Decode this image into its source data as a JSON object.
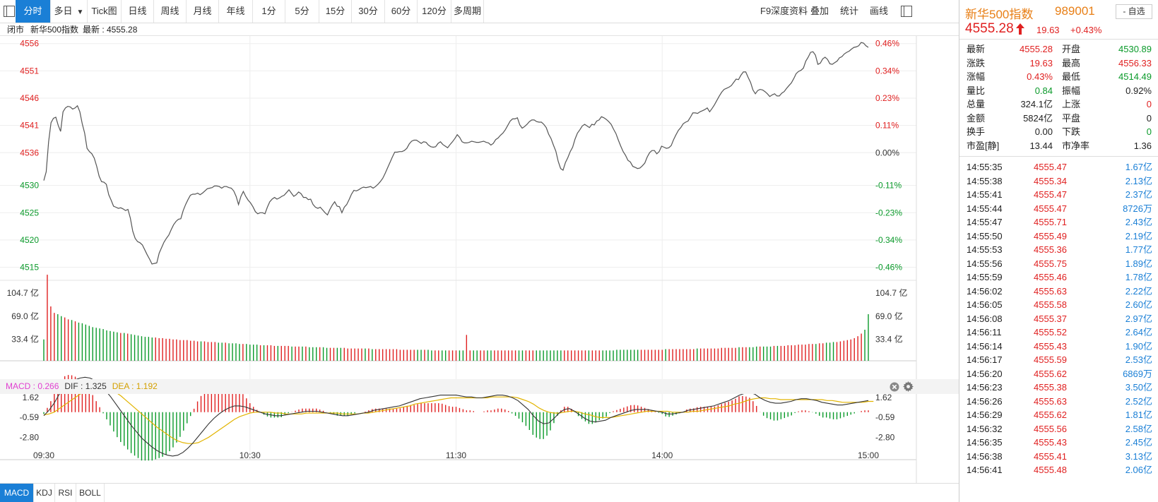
{
  "toolbar": {
    "buttons": [
      "分时",
      "多日",
      "Tick图",
      "日线",
      "周线",
      "月线",
      "年线",
      "1分",
      "5分",
      "15分",
      "30分",
      "60分",
      "120分",
      "多周期"
    ],
    "active": "分时",
    "multi_day_caret": "▼",
    "right_buttons": [
      "F9深度资料",
      "叠加",
      "统计",
      "画线"
    ]
  },
  "status": {
    "market": "闭市",
    "name": "新华500指数",
    "latest_label": "最新 : 4555.28"
  },
  "macd_header": {
    "macd": "MACD : 0.266",
    "dif": "DIF : 1.325",
    "dea": "DEA : 1.192"
  },
  "bottom_tabs": [
    "MACD",
    "KDJ",
    "RSI",
    "BOLL"
  ],
  "colors": {
    "up": "#e02020",
    "down": "#0a9a2a",
    "accent": "#1a7fd6",
    "quote_title": "#e87f16",
    "dif": "#333333",
    "dea": "#e2b400",
    "macd_label": "#e040d0"
  },
  "quote": {
    "name": "新华500指数",
    "code": "989001",
    "fav_label": "- 自选",
    "price": "4555.28",
    "change": "19.63",
    "change_pct": "+0.43%",
    "rows": [
      {
        "l1": "最新",
        "v1": "4555.28",
        "c1": "red",
        "l2": "开盘",
        "v2": "4530.89",
        "c2": "green"
      },
      {
        "l1": "涨跌",
        "v1": "19.63",
        "c1": "red",
        "l2": "最高",
        "v2": "4556.33",
        "c2": "red"
      },
      {
        "l1": "涨幅",
        "v1": "0.43%",
        "c1": "red",
        "l2": "最低",
        "v2": "4514.49",
        "c2": "green"
      },
      {
        "l1": "量比",
        "v1": "0.84",
        "c1": "green",
        "l2": "振幅",
        "v2": "0.92%",
        "c2": "blk"
      },
      {
        "l1": "总量",
        "v1": "324.1亿",
        "c1": "blk",
        "l2": "上涨",
        "v2": "0",
        "c2": "red"
      },
      {
        "l1": "金额",
        "v1": "5824亿",
        "c1": "blk",
        "l2": "平盘",
        "v2": "0",
        "c2": "blk"
      },
      {
        "l1": "换手",
        "v1": "0.00",
        "c1": "blk",
        "l2": "下跌",
        "v2": "0",
        "c2": "green"
      },
      {
        "l1": "市盈[静]",
        "v1": "13.44",
        "c1": "blk",
        "l2": "市净率",
        "v2": "1.36",
        "c2": "blk"
      }
    ],
    "ticks": [
      {
        "t": "14:55:35",
        "p": "4555.47",
        "v": "1.67亿"
      },
      {
        "t": "14:55:38",
        "p": "4555.34",
        "v": "2.13亿"
      },
      {
        "t": "14:55:41",
        "p": "4555.47",
        "v": "2.37亿"
      },
      {
        "t": "14:55:44",
        "p": "4555.47",
        "v": "8726万"
      },
      {
        "t": "14:55:47",
        "p": "4555.71",
        "v": "2.43亿"
      },
      {
        "t": "14:55:50",
        "p": "4555.49",
        "v": "2.19亿"
      },
      {
        "t": "14:55:53",
        "p": "4555.36",
        "v": "1.77亿"
      },
      {
        "t": "14:55:56",
        "p": "4555.75",
        "v": "1.89亿"
      },
      {
        "t": "14:55:59",
        "p": "4555.46",
        "v": "1.78亿"
      },
      {
        "t": "14:56:02",
        "p": "4555.63",
        "v": "2.22亿"
      },
      {
        "t": "14:56:05",
        "p": "4555.58",
        "v": "2.60亿"
      },
      {
        "t": "14:56:08",
        "p": "4555.37",
        "v": "2.97亿"
      },
      {
        "t": "14:56:11",
        "p": "4555.52",
        "v": "2.64亿"
      },
      {
        "t": "14:56:14",
        "p": "4555.43",
        "v": "1.90亿"
      },
      {
        "t": "14:56:17",
        "p": "4555.59",
        "v": "2.53亿"
      },
      {
        "t": "14:56:20",
        "p": "4555.62",
        "v": "6869万"
      },
      {
        "t": "14:56:23",
        "p": "4555.38",
        "v": "3.50亿"
      },
      {
        "t": "14:56:26",
        "p": "4555.63",
        "v": "2.52亿"
      },
      {
        "t": "14:56:29",
        "p": "4555.62",
        "v": "1.81亿"
      },
      {
        "t": "14:56:32",
        "p": "4555.56",
        "v": "2.58亿"
      },
      {
        "t": "14:56:35",
        "p": "4555.43",
        "v": "2.45亿"
      },
      {
        "t": "14:56:38",
        "p": "4555.41",
        "v": "3.13亿"
      },
      {
        "t": "14:56:41",
        "p": "4555.48",
        "v": "2.06亿"
      }
    ]
  },
  "chart_data": {
    "type": "line",
    "prev_close": 4535.65,
    "price_axis": {
      "ylim": [
        4513,
        4557
      ],
      "left_ticks": [
        "4556",
        "4551",
        "4546",
        "4541",
        "4536",
        "4530",
        "4525",
        "4520",
        "4515"
      ],
      "left_tick_values": [
        4556,
        4551,
        4546,
        4541,
        4536,
        4530,
        4525,
        4520,
        4515
      ],
      "right_ticks": [
        "0.46%",
        "0.34%",
        "0.23%",
        "0.11%",
        "0.00%",
        "-0.11%",
        "-0.23%",
        "-0.34%",
        "-0.46%"
      ]
    },
    "time_ticks": [
      "09:30",
      "10:30",
      "11:30",
      "14:00",
      "15:00"
    ],
    "time_tick_index": [
      0,
      60,
      120,
      180,
      240
    ],
    "price": [
      4530.9,
      4532.5,
      4538,
      4541.5,
      4542.3,
      4542.5,
      4541,
      4539.9,
      4543.5,
      4544.2,
      4544.5,
      4544.4,
      4544,
      4544.2,
      4544.6,
      4543.5,
      4541.3,
      4539.6,
      4536.8,
      4536.2,
      4535.8,
      4535,
      4533.5,
      4531.7,
      4530.7,
      4530.6,
      4530.2,
      4528.3,
      4527.3,
      4526.2,
      4526,
      4525.8,
      4525.9,
      4525.7,
      4525.4,
      4525.6,
      4524,
      4521.6,
      4520.3,
      4519.7,
      4519.5,
      4519.1,
      4518.2,
      4517.3,
      4516.5,
      4515.6,
      4515.7,
      4515.8,
      4517.6,
      4518.6,
      4519.6,
      4520.3,
      4520.9,
      4521.9,
      4522.8,
      4523.4,
      4523.8,
      4523.9,
      4525.4,
      4526.5,
      4527.4,
      4528.2,
      4528.4,
      4528.4,
      4528.6,
      4528.3,
      4528.6,
      4529,
      4529.4,
      4529.5,
      4529.6,
      4529.9,
      4529.9,
      4529.8,
      4529.5,
      4529.8,
      4529.8,
      4529.6,
      4529.5,
      4529,
      4528,
      4526.5,
      4528,
      4528.9,
      4528,
      4527.3,
      4526.8,
      4526.1,
      4525.2,
      4524.8,
      4525,
      4525,
      4524.8,
      4526,
      4527,
      4527.5,
      4527.8,
      4527.5,
      4527.7,
      4528,
      4528.2,
      4528.7,
      4529.2,
      4528.6,
      4528,
      4528.3,
      4528.8,
      4528.5,
      4527.8,
      4527.8,
      4527.4,
      4527.5,
      4526.5,
      4526,
      4525.8,
      4526,
      4525.5,
      4525,
      4524.6,
      4525.6,
      4526.4,
      4527,
      4526.2,
      4526.1,
      4525,
      4526,
      4526.5,
      4527.4,
      4528.4,
      4529.1,
      4529,
      4529.2,
      4529.5,
      4529.7,
      4529.6,
      4529.7,
      4529.8,
      4529.5,
      4529.8,
      4530.2,
      4530.7,
      4531.3,
      4532.2,
      4533.2,
      4534.2,
      4535.2,
      4536.1,
      4536.1,
      4536.2,
      4536.2,
      4536.4,
      4536.8,
      4537.6,
      4538.1,
      4538.3,
      4538.3,
      4538,
      4537.7,
      4538,
      4537.9,
      4537.4,
      4537.1,
      4537,
      4537.1,
      4537.7,
      4538,
      4537.5,
      4537.2,
      4536.9,
      4537.5,
      4538,
      4538.6,
      4539.3,
      4538.8,
      4538,
      4537.8,
      4537.8,
      4537.9,
      4538.1,
      4538,
      4537.9,
      4537.9,
      4538,
      4538.1,
      4537.9,
      4537.8,
      4537.4,
      4537.7,
      4538.4,
      4538.7,
      4539.2,
      4539.6,
      4540.2,
      4541,
      4541.8,
      4542.2,
      4542.2,
      4542.4,
      4541.1,
      4540.5,
      4540.8,
      4541.2,
      4541.7,
      4542,
      4542,
      4541.7,
      4541.6,
      4541.6,
      4541.2,
      4540.6,
      4539.4,
      4538.6,
      4537.4,
      4536.3,
      4534.4,
      4533.1,
      4532.8,
      4534.2,
      4535.1,
      4536.2,
      4537,
      4538.5,
      4539.6,
      4540.2,
      4540.9,
      4541.2,
      4540.9,
      4540.6,
      4541.2,
      4541.1,
      4541.8,
      4542,
      4542.6,
      4542.4,
      4542.1,
      4541.7,
      4541.2,
      4540.3,
      4539.5,
      4538.3,
      4537.2,
      4536.2,
      4535.5,
      4534.6,
      4534.3,
      4533.5,
      4533.3,
      4533.1,
      4533.2,
      4533.6,
      4534.1,
      4535.2,
      4536,
      4536.4,
      4536.4,
      4535.8,
      4536.2,
      4537.2,
      4537,
      4536.8,
      4536.9,
      4537.3,
      4538.4,
      4539.3,
      4540.1,
      4540.6,
      4541.3,
      4541.6,
      4541.8,
      4542.5,
      4543.3,
      4543.3,
      4543.2,
      4543.5,
      4543.7,
      4543.9,
      4544.2,
      4543.5,
      4544.1,
      4544.8,
      4545.6,
      4546.4,
      4547.1,
      4547.6,
      4547.8,
      4548,
      4548.3,
      4548.9,
      4549.5,
      4549.4,
      4550.2,
      4550.8,
      4550.8,
      4549.8,
      4548.9,
      4547.5,
      4546.8,
      4547.4,
      4547.6,
      4547.5,
      4547.2,
      4546.8,
      4546.3,
      4546.6,
      4546.8,
      4546.4,
      4546.4,
      4546.9,
      4547.2,
      4547.8,
      4548.3,
      4548.8,
      4549.6,
      4550.5,
      4550.9,
      4551.1,
      4551.5,
      4552.8,
      4553.5,
      4554.4,
      4554.5,
      4553.9,
      4552.2,
      4552.4,
      4553.2,
      4553.5,
      4553.1,
      4552.3,
      4552.2,
      4552.5,
      4552.8,
      4553.4,
      4553.6,
      4554.1,
      4554.4,
      4554.6,
      4555,
      4555.3,
      4555.4,
      4555.6,
      4556.2,
      4556.1,
      4555.6,
      4555.3
    ],
    "volume_axis": {
      "ticks": [
        "104.7 亿",
        "69.0 亿",
        "33.4 亿"
      ],
      "tick_values": [
        104.7,
        69.0,
        33.4
      ],
      "ylim": [
        0,
        120
      ]
    },
    "volume": [
      33,
      133,
      84,
      74,
      72,
      69,
      67,
      64,
      63,
      61,
      59,
      58,
      56,
      54,
      52,
      51,
      50,
      49,
      47,
      46,
      45,
      44,
      43,
      43,
      42,
      41,
      40,
      39,
      38,
      37,
      37,
      36,
      36,
      35,
      35,
      34,
      34,
      33,
      33,
      32,
      32,
      32,
      31,
      31,
      30,
      30,
      30,
      29,
      29,
      29,
      28,
      28,
      28,
      27,
      27,
      27,
      26,
      26,
      26,
      25,
      25,
      25,
      24,
      24,
      24,
      24,
      23,
      23,
      23,
      23,
      23,
      22,
      22,
      22,
      22,
      22,
      21,
      21,
      21,
      21,
      21,
      20,
      20,
      20,
      20,
      20,
      20,
      19,
      19,
      19,
      19,
      19,
      19,
      19,
      18,
      18,
      18,
      18,
      18,
      18,
      18,
      18,
      17,
      17,
      17,
      17,
      17,
      17,
      17,
      17,
      17,
      16,
      16,
      16,
      16,
      16,
      16,
      16,
      16,
      16,
      16,
      40,
      16,
      16,
      16,
      16,
      16,
      16,
      16,
      16,
      16,
      16,
      16,
      16,
      16,
      16,
      16,
      16,
      16,
      16,
      16,
      16,
      16,
      16,
      16,
      16,
      16,
      16,
      16,
      16,
      16,
      16,
      16,
      16,
      16,
      16,
      16,
      16,
      16,
      16,
      16,
      16,
      16,
      16,
      17,
      17,
      17,
      17,
      17,
      17,
      17,
      17,
      17,
      17,
      17,
      17,
      17,
      17,
      18,
      18,
      18,
      18,
      18,
      18,
      18,
      18,
      18,
      19,
      19,
      19,
      19,
      19,
      19,
      19,
      20,
      20,
      20,
      20,
      20,
      21,
      21,
      21,
      21,
      21,
      22,
      22,
      22,
      22,
      22,
      23,
      23,
      23,
      23,
      24,
      24,
      24,
      25,
      25,
      25,
      26,
      26,
      26,
      27,
      27,
      28,
      28,
      29,
      29,
      30,
      31,
      32,
      33,
      35,
      38,
      42,
      48,
      72
    ],
    "macd_axis": {
      "ticks": [
        "1.62",
        "-0.59",
        "-2.80"
      ],
      "tick_values": [
        1.62,
        -0.59,
        -2.8
      ],
      "ylim": [
        -5.3,
        4.0
      ]
    },
    "dif": [
      -0.4,
      0.2,
      1.0,
      2.0,
      2.8,
      3.3,
      3.6,
      3.8,
      3.9,
      3.8,
      3.5,
      3.0,
      2.4,
      1.7,
      0.9,
      0.1,
      -0.7,
      -1.5,
      -2.2,
      -2.9,
      -3.4,
      -3.9,
      -4.3,
      -4.6,
      -4.8,
      -4.9,
      -4.8,
      -4.5,
      -4.0,
      -3.4,
      -2.7,
      -2.0,
      -1.3,
      -0.7,
      -0.2,
      0.2,
      0.5,
      0.7,
      0.7,
      0.6,
      0.4,
      0.2,
      0.0,
      -0.2,
      -0.3,
      -0.4,
      -0.4,
      -0.3,
      -0.2,
      -0.1,
      0.0,
      0.1,
      0.1,
      0.1,
      0.0,
      -0.1,
      -0.2,
      -0.3,
      -0.4,
      -0.4,
      -0.3,
      -0.2,
      -0.1,
      0.0,
      0.2,
      0.3,
      0.4,
      0.5,
      0.6,
      0.7,
      0.9,
      1.1,
      1.3,
      1.5,
      1.6,
      1.7,
      1.8,
      1.9,
      1.9,
      1.9,
      1.9,
      1.8,
      1.7,
      1.7,
      1.6,
      1.6,
      1.7,
      1.8,
      1.9,
      1.9,
      1.8,
      1.6,
      1.3,
      0.8,
      0.3,
      -0.4,
      -1.0,
      -1.3,
      -1.2,
      -0.7,
      -0.1,
      0.3,
      0.4,
      0.1,
      -0.3,
      -0.7,
      -1.0,
      -1.1,
      -1.0,
      -0.9,
      -0.6,
      -0.4,
      -0.2,
      0.0,
      0.2,
      0.3,
      0.3,
      0.3,
      0.2,
      0.1,
      0.0,
      -0.2,
      -0.2,
      -0.1,
      0.0,
      0.2,
      0.3,
      0.4,
      0.5,
      0.6,
      0.7,
      0.9,
      1.1,
      1.3,
      1.6,
      1.9,
      2.1,
      2.2,
      2.0,
      1.6,
      1.3,
      1.1,
      1.0,
      1.0,
      1.1,
      1.2,
      1.4,
      1.5,
      1.5,
      1.4,
      1.3,
      1.1,
      1.0,
      0.9,
      0.8,
      0.8,
      0.9,
      1.0,
      1.1,
      1.2,
      1.3
    ],
    "dea": [
      -0.3,
      -0.2,
      0.0,
      0.4,
      0.8,
      1.2,
      1.6,
      2.0,
      2.3,
      2.6,
      2.8,
      2.8,
      2.7,
      2.5,
      2.2,
      1.8,
      1.3,
      0.8,
      0.3,
      -0.2,
      -0.7,
      -1.2,
      -1.7,
      -2.1,
      -2.5,
      -2.9,
      -3.2,
      -3.4,
      -3.5,
      -3.5,
      -3.4,
      -3.1,
      -2.8,
      -2.4,
      -2.0,
      -1.6,
      -1.2,
      -0.8,
      -0.5,
      -0.3,
      -0.1,
      0.0,
      0.0,
      0.0,
      0.0,
      -0.1,
      -0.1,
      -0.2,
      -0.2,
      -0.2,
      -0.2,
      -0.1,
      -0.1,
      -0.1,
      -0.1,
      -0.1,
      -0.1,
      -0.1,
      -0.2,
      -0.2,
      -0.2,
      -0.2,
      -0.1,
      -0.1,
      0.0,
      0.1,
      0.2,
      0.3,
      0.4,
      0.5,
      0.6,
      0.7,
      0.9,
      1.0,
      1.1,
      1.2,
      1.3,
      1.4,
      1.5,
      1.6,
      1.6,
      1.6,
      1.6,
      1.6,
      1.6,
      1.6,
      1.6,
      1.7,
      1.7,
      1.7,
      1.7,
      1.7,
      1.6,
      1.4,
      1.2,
      0.9,
      0.5,
      0.2,
      0.0,
      -0.1,
      -0.1,
      0.0,
      0.1,
      0.1,
      0.0,
      -0.2,
      -0.3,
      -0.5,
      -0.6,
      -0.6,
      -0.6,
      -0.5,
      -0.4,
      -0.3,
      -0.2,
      -0.1,
      0.0,
      0.1,
      0.1,
      0.1,
      0.1,
      0.1,
      0.0,
      0.0,
      0.0,
      0.0,
      0.1,
      0.1,
      0.2,
      0.3,
      0.4,
      0.5,
      0.6,
      0.7,
      0.9,
      1.0,
      1.2,
      1.4,
      1.5,
      1.6,
      1.6,
      1.5,
      1.5,
      1.4,
      1.4,
      1.4,
      1.4,
      1.4,
      1.4,
      1.4,
      1.4,
      1.4,
      1.3,
      1.3,
      1.2,
      1.1,
      1.1,
      1.1,
      1.1,
      1.1,
      1.2,
      1.2
    ]
  }
}
